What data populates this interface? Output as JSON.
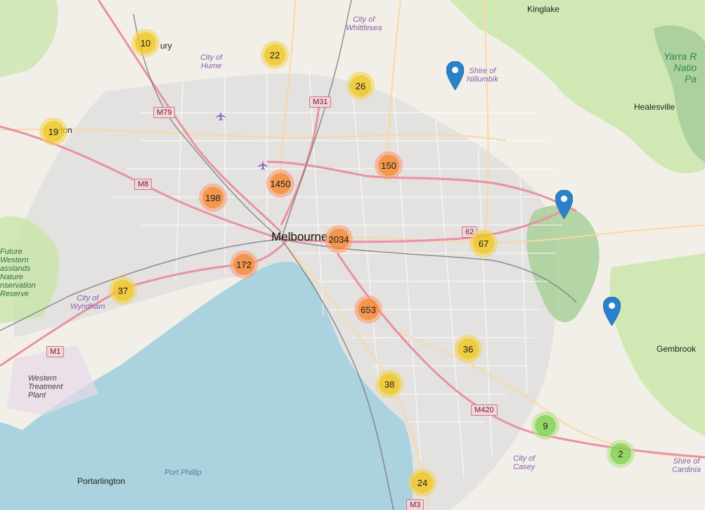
{
  "map": {
    "colors": {
      "water": "#aad3df",
      "land": "#f2efe9",
      "urban": "#e0dfdf",
      "park": "#c8e6a8",
      "forest": "#add19e",
      "motorway": "#e892a2",
      "trunk": "#f9b29c",
      "primary": "#fcd6a4",
      "minor": "#ffffff",
      "rail": "#777777",
      "cluster_small": "#6ecc39",
      "cluster_medium": "#f0c20c",
      "cluster_large": "#f18017",
      "pin": "#2a81cb"
    },
    "places": {
      "melbourne": "Melbourne",
      "kinglake": "Kinglake",
      "healesville": "Healesville",
      "gembrook": "Gembrook",
      "portarlington": "Portarlington",
      "sunbury_partial": "ury",
      "melton_partial": "ton"
    },
    "lgas": {
      "whittlesea": [
        "City of",
        "Whittlesea"
      ],
      "hume": [
        "City of",
        "Hume"
      ],
      "nillumbik": [
        "Shire of",
        "Nillumbik"
      ],
      "wyndham": [
        "City of",
        "Wyndham"
      ],
      "casey": [
        "City of",
        "Casey"
      ],
      "cardinia": [
        "Shire of",
        "Cardinia"
      ]
    },
    "park_label": [
      "Yarra R",
      "Natio",
      "Pa"
    ],
    "nature_reserve": [
      "Future",
      "Western",
      "asslands",
      "Nature",
      "nservation",
      "Reserve"
    ],
    "treatment_plant": [
      "Western",
      "Treatment",
      "Plant"
    ],
    "water_label": "Port Phillip",
    "roads": [
      "M79",
      "M31",
      "M8",
      "M1",
      "M420",
      "M3",
      "62"
    ],
    "clusters": [
      {
        "count": "10",
        "size": "medium"
      },
      {
        "count": "22",
        "size": "medium"
      },
      {
        "count": "26",
        "size": "medium"
      },
      {
        "count": "19",
        "size": "medium"
      },
      {
        "count": "150",
        "size": "large"
      },
      {
        "count": "1450",
        "size": "large"
      },
      {
        "count": "198",
        "size": "large"
      },
      {
        "count": "2034",
        "size": "large"
      },
      {
        "count": "67",
        "size": "medium"
      },
      {
        "count": "172",
        "size": "large"
      },
      {
        "count": "37",
        "size": "medium"
      },
      {
        "count": "653",
        "size": "large"
      },
      {
        "count": "36",
        "size": "medium"
      },
      {
        "count": "38",
        "size": "medium"
      },
      {
        "count": "9",
        "size": "small"
      },
      {
        "count": "2",
        "size": "small"
      },
      {
        "count": "24",
        "size": "medium"
      }
    ],
    "markers": [
      "location-pin",
      "location-pin",
      "location-pin"
    ],
    "airports": [
      "airport-icon",
      "airport-icon"
    ]
  }
}
